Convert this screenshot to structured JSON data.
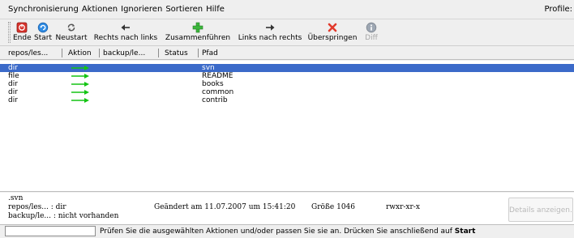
{
  "menubar": {
    "items": [
      "Synchronisierung",
      "Aktionen",
      "Ignorieren",
      "Sortieren",
      "Hilfe"
    ],
    "right_label": "Profile:"
  },
  "toolbar": {
    "buttons": [
      {
        "label": "Ende",
        "icon": "stop-icon",
        "enabled": true
      },
      {
        "label": "Start",
        "icon": "refresh-start-icon",
        "enabled": true
      },
      {
        "label": "Neustart",
        "icon": "restart-icon",
        "enabled": true
      },
      {
        "label": "Rechts nach links",
        "icon": "arrow-left-icon",
        "enabled": true
      },
      {
        "label": "Zusammenführen",
        "icon": "merge-icon",
        "enabled": true
      },
      {
        "label": "Links nach rechts",
        "icon": "arrow-right-icon",
        "enabled": true
      },
      {
        "label": "Überspringen",
        "icon": "skip-x-icon",
        "enabled": true
      },
      {
        "label": "Diff",
        "icon": "diff-info-icon",
        "enabled": false
      }
    ]
  },
  "table": {
    "columns": [
      "repos/les...",
      "Aktion",
      "backup/le...",
      "Status",
      "Pfad"
    ],
    "rows": [
      {
        "type": "dir",
        "action": "left-to-right",
        "path": "svn",
        "selected": true
      },
      {
        "type": "file",
        "action": "left-to-right",
        "path": "README",
        "selected": false
      },
      {
        "type": "dir",
        "action": "left-to-right",
        "path": "books",
        "selected": false
      },
      {
        "type": "dir",
        "action": "left-to-right",
        "path": "common",
        "selected": false
      },
      {
        "type": "dir",
        "action": "left-to-right",
        "path": "contrib",
        "selected": false
      }
    ]
  },
  "details": {
    "name": ".svn",
    "left_line": "repos/les... : dir",
    "changed": "Geändert am 11.07.2007 um 15:41:20",
    "size": "Größe 1046",
    "perms": "rwxr-xr-x",
    "right_line": "backup/le... : nicht vorhanden",
    "button_label": "Details anzeigen..."
  },
  "status": {
    "input_value": "",
    "message": "Prüfen Sie die ausgewählten Aktionen und/oder passen Sie sie an. Drücken Sie anschließend auf ",
    "message_bold": "Start"
  },
  "colors": {
    "selection": "#3b6ac9",
    "arrow_green": "#13c413"
  }
}
